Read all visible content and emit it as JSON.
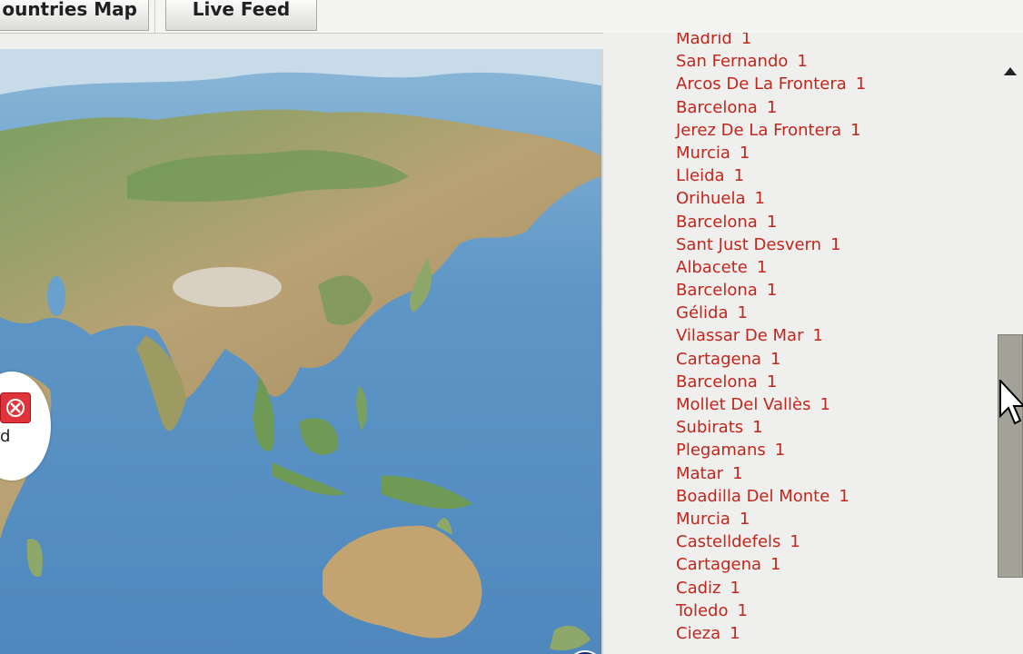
{
  "tabs": [
    {
      "label": "ountries Map"
    },
    {
      "label": "Live Feed"
    }
  ],
  "map": {
    "popup_text": "d",
    "popup_close_icon": "close-x-icon",
    "zoom_icon": "plus-icon",
    "colors": {
      "ocean": "#5f97c5",
      "land": "#b9a276",
      "forest": "#6c9a58"
    }
  },
  "feed": {
    "accent_color": "#c3261b",
    "items": [
      {
        "city": "Madrid",
        "count": "1"
      },
      {
        "city": "San Fernando",
        "count": "1"
      },
      {
        "city": "Arcos De La Frontera",
        "count": "1"
      },
      {
        "city": "Barcelona",
        "count": "1"
      },
      {
        "city": "Jerez De La Frontera",
        "count": "1"
      },
      {
        "city": "Murcia",
        "count": "1"
      },
      {
        "city": "Lleida",
        "count": "1"
      },
      {
        "city": "Orihuela",
        "count": "1"
      },
      {
        "city": "Barcelona",
        "count": "1"
      },
      {
        "city": "Sant Just Desvern",
        "count": "1"
      },
      {
        "city": "Albacete",
        "count": "1"
      },
      {
        "city": "Barcelona",
        "count": "1"
      },
      {
        "city": "Gélida",
        "count": "1"
      },
      {
        "city": "Vilassar De Mar",
        "count": "1"
      },
      {
        "city": "Cartagena",
        "count": "1"
      },
      {
        "city": "Barcelona",
        "count": "1"
      },
      {
        "city": "Mollet Del Vallès",
        "count": "1"
      },
      {
        "city": "Subirats",
        "count": "1"
      },
      {
        "city": "Plegamans",
        "count": "1"
      },
      {
        "city": "Matar",
        "count": "1"
      },
      {
        "city": "Boadilla Del Monte",
        "count": "1"
      },
      {
        "city": "Murcia",
        "count": "1"
      },
      {
        "city": "Castelldefels",
        "count": "1"
      },
      {
        "city": "Cartagena",
        "count": "1"
      },
      {
        "city": "Cadiz",
        "count": "1"
      },
      {
        "city": "Toledo",
        "count": "1"
      },
      {
        "city": "Cieza",
        "count": "1"
      }
    ]
  }
}
